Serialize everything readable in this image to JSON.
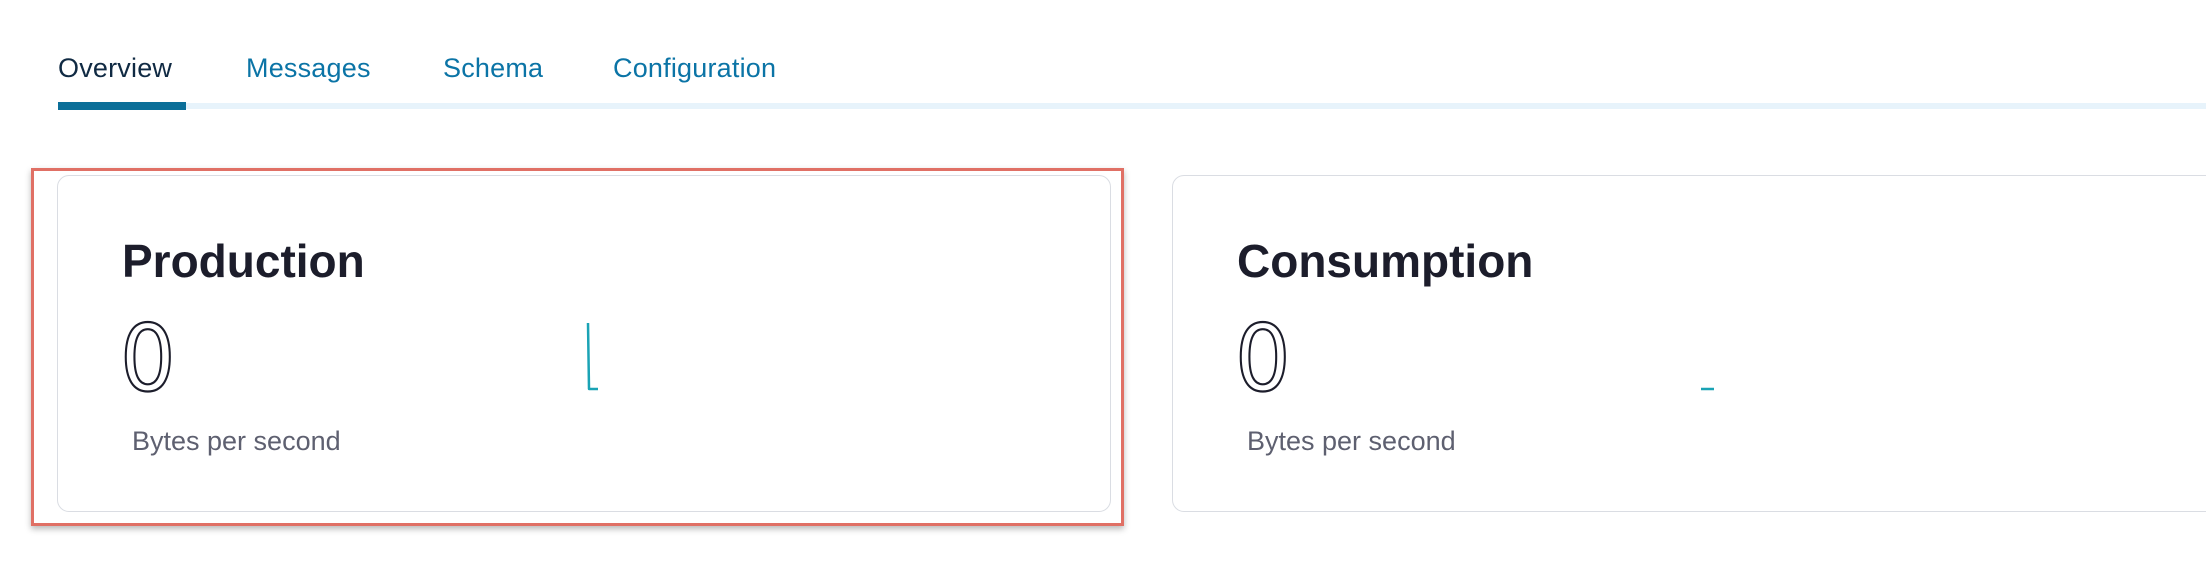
{
  "tabs": [
    {
      "label": "Overview",
      "active": true
    },
    {
      "label": "Messages",
      "active": false
    },
    {
      "label": "Schema",
      "active": false
    },
    {
      "label": "Configuration",
      "active": false
    }
  ],
  "cards": {
    "production": {
      "title": "Production",
      "value": "0",
      "unit": "Bytes per second"
    },
    "consumption": {
      "title": "Consumption",
      "value": "0",
      "unit": "Bytes per second"
    }
  },
  "colors": {
    "tab_link": "#0b74a6",
    "tab_active_text": "#102a43",
    "tab_indicator": "#0b6f99",
    "sparkline": "#1aa3b5",
    "highlight": "#e07065"
  }
}
